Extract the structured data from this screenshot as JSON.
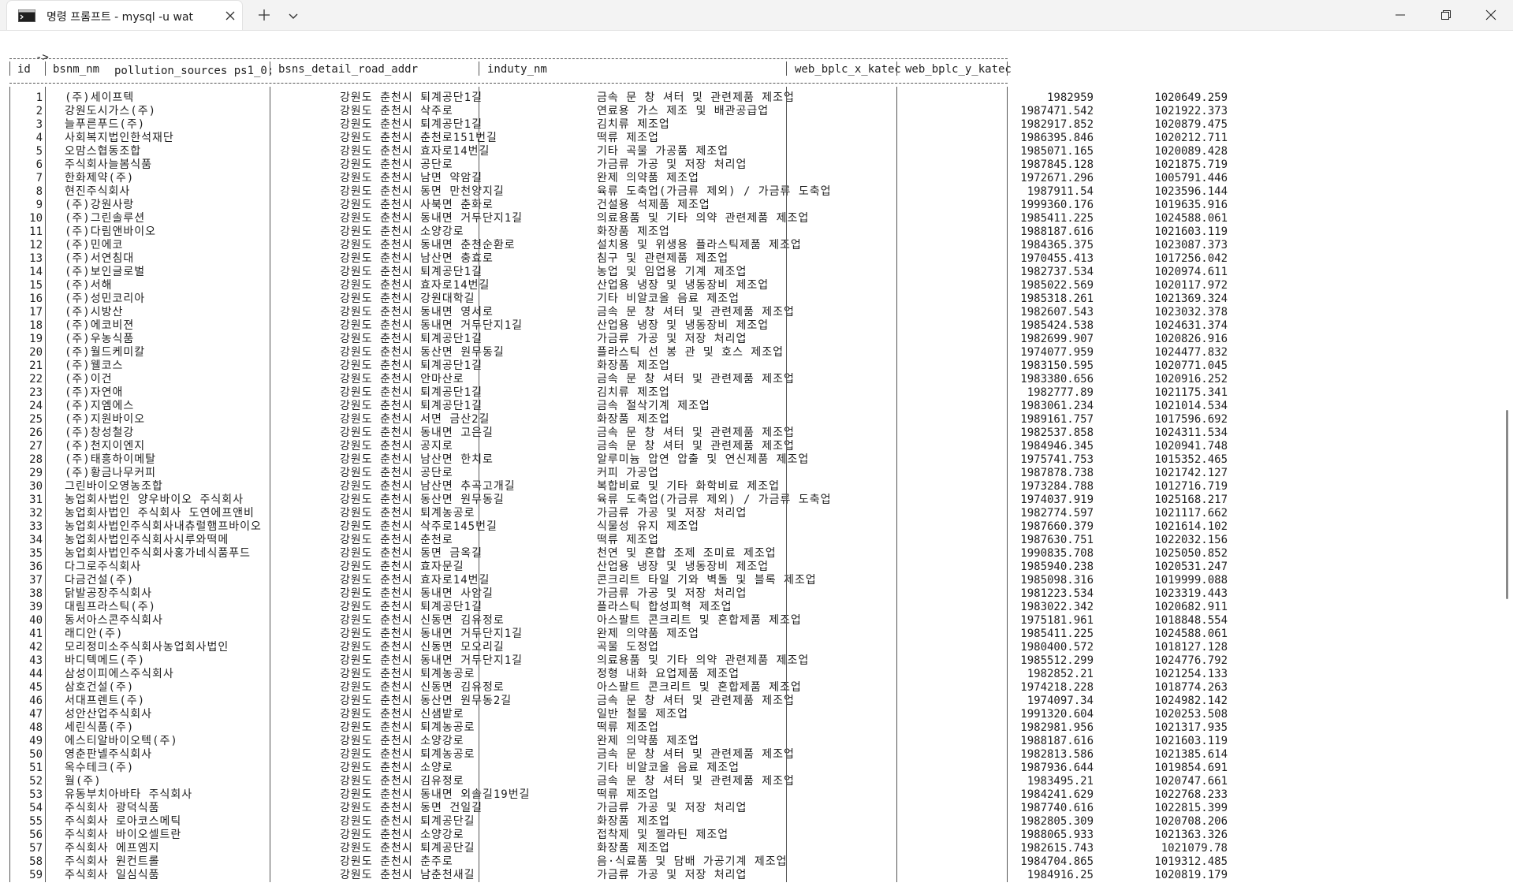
{
  "tab": {
    "title": "명령 프롬프트 - mysql  -u wat"
  },
  "prompt": {
    "arrow": "->",
    "command": "pollution_sources ps1_0;"
  },
  "columns": [
    "id",
    "bsnm_nm",
    "bsns_detail_road_addr",
    "induty_nm",
    "web_bplc_x_katec",
    "web_bplc_y_katec"
  ],
  "rows": [
    [
      "1",
      "(주)세이프텍",
      "강원도 춘천시 퇴계공단1길",
      "금속 문 창 셔터 및 관련제품 제조업",
      "1982959",
      "1020649.259"
    ],
    [
      "2",
      "강원도시가스(주)",
      "강원도 춘천시 삭주로",
      "연료용 가스 제조 및 배관공급업",
      "1987471.542",
      "1021922.373"
    ],
    [
      "3",
      "늘푸른푸드(주)",
      "강원도 춘천시 퇴계공단1길",
      "김치류 제조업",
      "1982917.852",
      "1020879.475"
    ],
    [
      "4",
      "사회복지법인한석재단",
      "강원도 춘천시 춘천로151번길",
      "떡류 제조업",
      "1986395.846",
      "1020212.711"
    ],
    [
      "5",
      "오맘스협동조합",
      "강원도 춘천시 효자로14번길",
      "기타 곡물 가공품 제조업",
      "1985071.165",
      "1020089.428"
    ],
    [
      "6",
      "주식회사늘봄식품",
      "강원도 춘천시 공단로",
      "가금류 가공 및 저장 처리업",
      "1987845.128",
      "1021875.719"
    ],
    [
      "7",
      "한화제약(주)",
      "강원도 춘천시 남면 약암길",
      "완제 의약품 제조업",
      "1972671.296",
      "1005791.446"
    ],
    [
      "8",
      "현진주식회사",
      "강원도 춘천시 동면 만천양지길",
      "육류 도축업(가금류 제외) / 가금류 도축업",
      "1987911.54",
      "1023596.144"
    ],
    [
      "9",
      "(주)강원사랑",
      "강원도 춘천시 사북면 춘화로",
      "건설용 석제품 제조업",
      "1999360.176",
      "1019635.916"
    ],
    [
      "10",
      "(주)그린솔루션",
      "강원도 춘천시 동내면 거두단지1길",
      "의료용품 및 기타 의약 관련제품 제조업",
      "1985411.225",
      "1024588.061"
    ],
    [
      "11",
      "(주)다림앤바이오",
      "강원도 춘천시 소양강로",
      "화장품 제조업",
      "1988187.616",
      "1021603.119"
    ],
    [
      "12",
      "(주)민에코",
      "강원도 춘천시 동내면 춘천순환로",
      "설치용 및 위생용 플라스틱제품 제조업",
      "1984365.375",
      "1023087.373"
    ],
    [
      "13",
      "(주)서연침대",
      "강원도 춘천시 남산면 충효로",
      "침구 및 관련제품 제조업",
      "1970455.413",
      "1017256.042"
    ],
    [
      "14",
      "(주)보인글로벌",
      "강원도 춘천시 퇴계공단1길",
      "농업 및 임업용 기계 제조업",
      "1982737.534",
      "1020974.611"
    ],
    [
      "15",
      "(주)서해",
      "강원도 춘천시 효자로14번길",
      "산업용 냉장 및 냉동장비 제조업",
      "1985022.569",
      "1020117.972"
    ],
    [
      "16",
      "(주)성민코리아",
      "강원도 춘천시 강원대학길",
      "기타 비알코올 음료 제조업",
      "1985318.261",
      "1021369.324"
    ],
    [
      "17",
      "(주)시방산",
      "강원도 춘천시 동내면 영서로",
      "금속 문 창 셔터 및 관련제품 제조업",
      "1982607.543",
      "1023032.378"
    ],
    [
      "18",
      "(주)에코비젼",
      "강원도 춘천시 동내면 거두단지1길",
      "산업용 냉장 및 냉동장비 제조업",
      "1985424.538",
      "1024631.374"
    ],
    [
      "19",
      "(주)우농식품",
      "강원도 춘천시 퇴계공단1길",
      "가금류 가공 및 저장 처리업",
      "1982699.907",
      "1020826.916"
    ],
    [
      "20",
      "(주)월드케미칼",
      "강원도 춘천시 동산면 원무동길",
      "플라스틱 선 봉 관 및 호스 제조업",
      "1974077.959",
      "1024477.832"
    ],
    [
      "21",
      "(주)웰코스",
      "강원도 춘천시 퇴계공단1길",
      "화장품 제조업",
      "1983150.595",
      "1020771.045"
    ],
    [
      "22",
      "(주)이건",
      "강원도 춘천시 안마산로",
      "금속 문 창 셔터 및 관련제품 제조업",
      "1983380.656",
      "1020916.252"
    ],
    [
      "23",
      "(주)자연애",
      "강원도 춘천시 퇴계공단1길",
      "김치류 제조업",
      "1982777.89",
      "1021175.341"
    ],
    [
      "24",
      "(주)지엠에스",
      "강원도 춘천시 퇴계공단1길",
      "금속 절삭기계 제조업",
      "1983061.234",
      "1021014.534"
    ],
    [
      "25",
      "(주)지원바이오",
      "강원도 춘천시 서면 금산2길",
      "화장품 제조업",
      "1989161.757",
      "1017596.692"
    ],
    [
      "26",
      "(주)창성철강",
      "강원도 춘천시 동내면 고은길",
      "금속 문 창 셔터 및 관련제품 제조업",
      "1982537.858",
      "1024311.534"
    ],
    [
      "27",
      "(주)천지이엔지",
      "강원도 춘천시 공지로",
      "금속 문 창 셔터 및 관련제품 제조업",
      "1984946.345",
      "1020941.748"
    ],
    [
      "28",
      "(주)태흥하이메탈",
      "강원도 춘천시 남산면 한치로",
      "알루미늄 압연 압출 및 연신제품 제조업",
      "1975741.753",
      "1015352.465"
    ],
    [
      "29",
      "(주)황금나무커피",
      "강원도 춘천시 공단로",
      "커피 가공업",
      "1987878.738",
      "1021742.127"
    ],
    [
      "30",
      "그린바이오영농조합",
      "강원도 춘천시 남산면 추곡고개길",
      "복합비료 및 기타 화학비료 제조업",
      "1973284.788",
      "1012716.719"
    ],
    [
      "31",
      "농업회사법인 양우바이오 주식회사",
      "강원도 춘천시 동산면 원무동길",
      "육류 도축업(가금류 제외) / 가금류 도축업",
      "1974037.919",
      "1025168.217"
    ],
    [
      "32",
      "농업회사법인 주식회사 도연에프앤비",
      "강원도 춘천시 퇴계농공로",
      "가금류 가공 및 저장 처리업",
      "1982774.597",
      "1021117.662"
    ],
    [
      "33",
      "농업회사법인주식회사내츄럴햄프바이오",
      "강원도 춘천시 삭주로145번길",
      "식물성 유지 제조업",
      "1987660.379",
      "1021614.102"
    ],
    [
      "34",
      "농업회사법인주식회사시루와떡메",
      "강원도 춘천시 춘천로",
      "떡류 제조업",
      "1987630.751",
      "1022032.156"
    ],
    [
      "35",
      "농업회사법인주식회사홍가네식품푸드",
      "강원도 춘천시 동면 금옥길",
      "천연 및 혼합 조제 조미료 제조업",
      "1990835.708",
      "1025050.852"
    ],
    [
      "36",
      "다그로주식회사",
      "강원도 춘천시 효자문길",
      "산업용 냉장 및 냉동장비 제조업",
      "1985940.238",
      "1020531.247"
    ],
    [
      "37",
      "다금건설(주)",
      "강원도 춘천시 효자로14번길",
      "콘크리트 타일 기와 벽돌 및 블록 제조업",
      "1985098.316",
      "1019999.088"
    ],
    [
      "38",
      "닭발공장주식회사",
      "강원도 춘천시 동내면 사암길",
      "가금류 가공 및 저장 처리업",
      "1981223.534",
      "1023319.443"
    ],
    [
      "39",
      "대림프라스틱(주)",
      "강원도 춘천시 퇴계공단1길",
      "플라스틱 합성피혁 제조업",
      "1983022.342",
      "1020682.911"
    ],
    [
      "40",
      "동서아스콘주식회사",
      "강원도 춘천시 신동면 김유정로",
      "아스팔트 콘크리트 및 혼합제품 제조업",
      "1975181.961",
      "1018848.554"
    ],
    [
      "41",
      "래디안(주)",
      "강원도 춘천시 동내면 거두단지1길",
      "완제 의약품 제조업",
      "1985411.225",
      "1024588.061"
    ],
    [
      "42",
      "모리정미소주식회사농업회사법인",
      "강원도 춘천시 신동면 모오리길",
      "곡물 도정업",
      "1980400.572",
      "1018127.128"
    ],
    [
      "43",
      "바디텍메드(주)",
      "강원도 춘천시 동내면 거두단지1길",
      "의료용품 및 기타 의약 관련제품 제조업",
      "1985512.299",
      "1024776.792"
    ],
    [
      "44",
      "삼성이피에스주식회사",
      "강원도 춘천시 퇴계농공로",
      "정형 내화 요업제품 제조업",
      "1982852.21",
      "1021254.133"
    ],
    [
      "45",
      "삼호건설(주)",
      "강원도 춘천시 신동면 김유정로",
      "아스팔트 콘크리트 및 혼합제품 제조업",
      "1974218.228",
      "1018774.263"
    ],
    [
      "46",
      "서대프렌트(주)",
      "강원도 춘천시 동산면 원무동2길",
      "금속 문 창 셔터 및 관련제품 제조업",
      "1974097.34",
      "1024982.142"
    ],
    [
      "47",
      "성안산업주식회사",
      "강원도 춘천시 신샘밭로",
      "일반 철물 제조업",
      "1991320.604",
      "1020253.508"
    ],
    [
      "48",
      "세린식품(주)",
      "강원도 춘천시 퇴계농공로",
      "떡류 제조업",
      "1982981.956",
      "1021317.935"
    ],
    [
      "49",
      "에스티알바이오텍(주)",
      "강원도 춘천시 소양강로",
      "완제 의약품 제조업",
      "1988187.616",
      "1021603.119"
    ],
    [
      "50",
      "영춘판넬주식회사",
      "강원도 춘천시 퇴계농공로",
      "금속 문 창 셔터 및 관련제품 제조업",
      "1982813.586",
      "1021385.614"
    ],
    [
      "51",
      "옥수테크(주)",
      "강원도 춘천시 소양로",
      "기타 비알코올 음료 제조업",
      "1987936.644",
      "1019854.691"
    ],
    [
      "52",
      "월(주)",
      "강원도 춘천시 김유정로",
      "금속 문 창 셔터 및 관련제품 제조업",
      "1983495.21",
      "1020747.661"
    ],
    [
      "53",
      "유동부치아바타 주식회사",
      "강원도 춘천시 동내면 외솔길19번길",
      "떡류 제조업",
      "1984241.629",
      "1022768.233"
    ],
    [
      "54",
      "주식회사 광덕식품",
      "강원도 춘천시 동면 건일길",
      "가금류 가공 및 저장 처리업",
      "1987740.616",
      "1022815.399"
    ],
    [
      "55",
      "주식회사 로아코스메틱",
      "강원도 춘천시 퇴계공단길",
      "화장품 제조업",
      "1982805.309",
      "1020708.206"
    ],
    [
      "56",
      "주식회사 바이오셀트란",
      "강원도 춘천시 소양강로",
      "접착제 및 젤라틴 제조업",
      "1988065.933",
      "1021363.326"
    ],
    [
      "57",
      "주식회사 에프엠지",
      "강원도 춘천시 퇴계공단길",
      "화장품 제조업",
      "1982615.743",
      "1021079.78"
    ],
    [
      "58",
      "주식회사 원컨트롤",
      "강원도 춘천시 춘주로",
      "음·식료품 및 담배 가공기계 제조업",
      "1984704.865",
      "1019312.485"
    ],
    [
      "59",
      "주식회사 일심식품",
      "강원도 춘천시 남춘천새길",
      "가금류 가공 및 저장 처리업",
      "1984916.25",
      "1020819.179"
    ]
  ]
}
